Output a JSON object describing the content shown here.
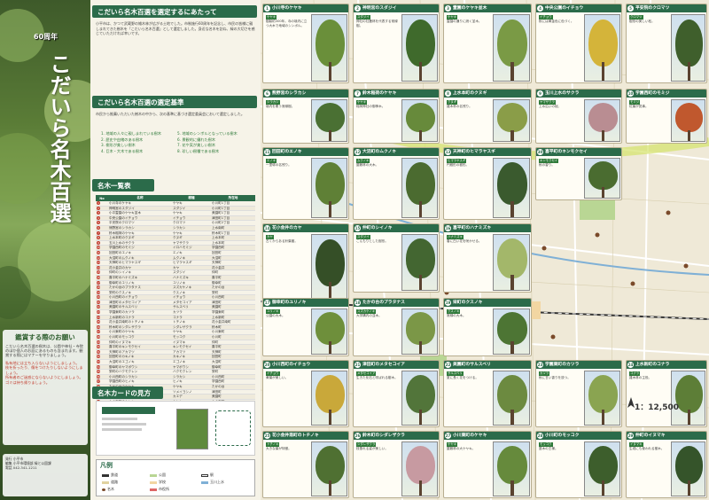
{
  "cover": {
    "anniversary": "60周年",
    "title": "こだいら名木百選",
    "request_title": "鑑賞する際のお願い",
    "request_intro": "こだいら名木百選の樹木は、公園や神社・寺院のほか個人のお庭にあるものも含まれます。観賞する際にはマナーを守りましょう。",
    "request_items": [
      "私有地には立ち入らないようにしましょう。",
      "枝を折ったり、傷をつけたりしないようにしましょう。",
      "所有者のご迷惑にならないようにしましょう。",
      "ゴミは持ち帰りましょう。"
    ],
    "footer": [
      "発行 小平市",
      "編集 小平市環境部 緑と公園課",
      "電話 042-341-1211"
    ]
  },
  "middle": {
    "section1_title": "こだいら名木百選を選定するにあたって",
    "section1_text": "小平市は、かつて武蔵野の雑木林が広がる土地でした。市制施行60周年を記念し、市民の皆様に親しまれてきた樹木を「こだいら名木百選」として選定しました。身近な名木を訪ね、緑の大切さを感じていただければ幸いです。",
    "section2_title": "こだいら名木百選の選定基準",
    "section2_text": "市民から推薦いただいた樹木の中から、次の基準に基づき選定委員会において選定しました。",
    "criteria_left": [
      "1. 地域の人々に親しまれている樹木",
      "2. 歴史や由緒のある樹木",
      "3. 樹形が美しい樹木",
      "4. 巨木・大木である樹木"
    ],
    "criteria_right": [
      "5. 地域のシンボルとなっている樹木",
      "6. 景観的に優れた樹木",
      "7. 花や実が美しい樹木",
      "8. 珍しい樹種である樹木"
    ],
    "list_title": "名木一覧表",
    "list_headers": [
      "No",
      "名称",
      "樹種",
      "所在地"
    ],
    "list_rows": [
      [
        "1",
        "小川寺のケヤキ",
        "ケヤキ",
        "小川町1丁目"
      ],
      [
        "2",
        "神明宮のスダジイ",
        "スダジイ",
        "小川町1丁目"
      ],
      [
        "3",
        "小平霊園のケヤキ並木",
        "ケヤキ",
        "美園町1丁目"
      ],
      [
        "4",
        "中央公園のイチョウ",
        "イチョウ",
        "津田町1丁目"
      ],
      [
        "5",
        "平安院のクロマツ",
        "クロマツ",
        "小川町2丁目"
      ],
      [
        "6",
        "熊野宮のシラカシ",
        "シラカシ",
        "上水南町"
      ],
      [
        "7",
        "鈴木稲荷のケヤキ",
        "ケヤキ",
        "鈴木町1丁目"
      ],
      [
        "8",
        "上水本町のクヌギ",
        "クヌギ",
        "上水本町"
      ],
      [
        "9",
        "玉川上水のサクラ",
        "ヤマザクラ",
        "上水本町"
      ],
      [
        "10",
        "学園西町のモミジ",
        "イロハモミジ",
        "学園西町"
      ],
      [
        "11",
        "回田町のエノキ",
        "エノキ",
        "回田町"
      ],
      [
        "12",
        "大沼町のムクノキ",
        "ムクノキ",
        "大沼町"
      ],
      [
        "13",
        "天神町のヒマラヤスギ",
        "ヒマラヤスギ",
        "天神町"
      ],
      [
        "14",
        "花小金井のカヤ",
        "カヤ",
        "花小金井"
      ],
      [
        "15",
        "仲町のシイノキ",
        "スダジイ",
        "仲町"
      ],
      [
        "16",
        "喜平町のハナミズキ",
        "ハナミズキ",
        "喜平町"
      ],
      [
        "17",
        "御幸町のユリノキ",
        "ユリノキ",
        "御幸町"
      ],
      [
        "18",
        "たかの台のプラタナス",
        "スズカケノキ",
        "たかの台"
      ],
      [
        "19",
        "栄町のクスノキ",
        "クスノキ",
        "栄町"
      ],
      [
        "20",
        "小川西町のイチョウ",
        "イチョウ",
        "小川西町"
      ],
      [
        "21",
        "津田町のメタセコイア",
        "メタセコイア",
        "津田町"
      ],
      [
        "22",
        "美園町のサルスベリ",
        "サルスベリ",
        "美園町"
      ],
      [
        "23",
        "学園東町のカツラ",
        "カツラ",
        "学園東町"
      ],
      [
        "24",
        "上水新町のコナラ",
        "コナラ",
        "上水新町"
      ],
      [
        "25",
        "花小金井南町のトチノキ",
        "トチノキ",
        "花小金井南町"
      ],
      [
        "26",
        "鈴木町のシダレザクラ",
        "シダレザクラ",
        "鈴木町"
      ],
      [
        "27",
        "小川東町のケヤキ",
        "ケヤキ",
        "小川東町"
      ],
      [
        "28",
        "小川町のモッコク",
        "モッコク",
        "小川町"
      ],
      [
        "29",
        "仲町のイヌマキ",
        "イヌマキ",
        "仲町"
      ],
      [
        "30",
        "喜平町のキンモクセイ",
        "キンモクセイ",
        "喜平町"
      ],
      [
        "31",
        "天神町のアカマツ",
        "アカマツ",
        "天神町"
      ],
      [
        "32",
        "回田町のカキノキ",
        "カキノキ",
        "回田町"
      ],
      [
        "33",
        "大沼町のエゴノキ",
        "エゴノキ",
        "大沼町"
      ],
      [
        "34",
        "御幸町のヤマボウシ",
        "ヤマボウシ",
        "御幸町"
      ],
      [
        "35",
        "栄町のハクモクレン",
        "ハクモクレン",
        "栄町"
      ],
      [
        "36",
        "小川西町のシラカシ",
        "シラカシ",
        "小川西町"
      ],
      [
        "37",
        "学園西町のヒノキ",
        "ヒノキ",
        "学園西町"
      ],
      [
        "38",
        "たかの台のケヤキ",
        "ケヤキ",
        "たかの台"
      ],
      [
        "39",
        "津田町のサクラ",
        "ソメイヨシノ",
        "津田町"
      ],
      [
        "40",
        "美園町のカエデ",
        "カエデ",
        "美園町"
      ],
      [
        "41",
        "上水本町のケヤキ",
        "ケヤキ",
        "上水本町"
      ],
      [
        "42",
        "花小金井のイチョウ",
        "イチョウ",
        "花小金井"
      ],
      [
        "43",
        "鈴木町のスギ",
        "スギ",
        "鈴木町"
      ],
      [
        "44",
        "小川東町のクスノキ",
        "クスノキ",
        "小川東町"
      ],
      [
        "45",
        "仲町のケヤキ",
        "ケヤキ",
        "仲町"
      ],
      [
        "46",
        "喜平町のサクラ",
        "ソメイヨシノ",
        "喜平町"
      ],
      [
        "47",
        "天神町のシイノキ",
        "スダジイ",
        "天神町"
      ],
      [
        "48",
        "回田町のエノキ",
        "エノキ",
        "回田町"
      ]
    ],
    "howto_title": "名木カードの見方",
    "legend_title": "凡例",
    "legend_items": [
      "鉄道",
      "道路",
      "名木",
      "公園",
      "学校",
      "市役所",
      "駅",
      "玉川上水"
    ]
  },
  "map": {
    "scale_label": "1：12,500",
    "cards": [
      {
        "no": "1",
        "name": "小川寺のケヤキ",
        "tag": "ケヤキ",
        "text": "樹齢約300年。寺の境内に立つ大木で地域のシンボル。",
        "canopy": "#6a8f3a"
      },
      {
        "no": "2",
        "name": "神明宮のスダジイ",
        "tag": "スダジイ",
        "text": "神社の社叢林を代表する常緑樹。",
        "canopy": "#3f6a2c"
      },
      {
        "no": "3",
        "name": "霊園のケヤキ並木",
        "tag": "ケヤキ",
        "text": "霊園の通りに続く並木。",
        "canopy": "#7a9a45"
      },
      {
        "no": "4",
        "name": "中央公園のイチョウ",
        "tag": "イチョウ",
        "text": "秋には黄金色に色づく。",
        "canopy": "#d4b43a"
      },
      {
        "no": "5",
        "name": "平安院のクロマツ",
        "tag": "クロマツ",
        "text": "樹形の美しい松。",
        "canopy": "#3f5f2c"
      },
      {
        "no": "6",
        "name": "熊野宮のシラカシ",
        "tag": "シラカシ",
        "text": "境内を覆う常緑樹。",
        "canopy": "#4a7033"
      },
      {
        "no": "7",
        "name": "鈴木稲荷のケヤキ",
        "tag": "ケヤキ",
        "text": "稲荷神社の御神木。",
        "canopy": "#678a3b"
      },
      {
        "no": "8",
        "name": "上水本町のクヌギ",
        "tag": "クヌギ",
        "text": "雑木林の名残り。",
        "canopy": "#8a9d48"
      },
      {
        "no": "9",
        "name": "玉川上水のサクラ",
        "tag": "ヤマザクラ",
        "text": "上水沿いの桜。",
        "canopy": "#b98d92"
      },
      {
        "no": "10",
        "name": "学園西町のモミジ",
        "tag": "モミジ",
        "text": "紅葉が見事。",
        "canopy": "#c0582e"
      },
      {
        "no": "11",
        "name": "回田町のエノキ",
        "tag": "エノキ",
        "text": "一里塚の名残り。",
        "canopy": "#5f8036"
      },
      {
        "no": "12",
        "name": "大沼町のムクノキ",
        "tag": "ムクノキ",
        "text": "屋敷林の大木。",
        "canopy": "#4b6b30"
      },
      {
        "no": "13",
        "name": "天神町のヒマラヤスギ",
        "tag": "ヒマラヤスギ",
        "text": "円錐形の樹形。",
        "canopy": "#3a5a2e"
      },
      {
        "no": "14",
        "name": "花小金井のカヤ",
        "tag": "カヤ",
        "text": "古くからある針葉樹。",
        "canopy": "#354f27"
      },
      {
        "no": "15",
        "name": "仲町のシイノキ",
        "tag": "スダジイ",
        "text": "こんもりとした樹形。",
        "canopy": "#436631"
      },
      {
        "no": "16",
        "name": "喜平町のハナミズキ",
        "tag": "ハナミズキ",
        "text": "春に白い花を咲かせる。",
        "canopy": "#a3b76a"
      },
      {
        "no": "17",
        "name": "御幸町のユリノキ",
        "tag": "ユリノキ",
        "text": "公園の大木。",
        "canopy": "#6e8f3b"
      },
      {
        "no": "18",
        "name": "たかの台のプラタナス",
        "tag": "スズカケノキ",
        "text": "大学構内の並木。",
        "canopy": "#7b9747"
      },
      {
        "no": "19",
        "name": "栄町のクスノキ",
        "tag": "クスノキ",
        "text": "常緑の大木。",
        "canopy": "#4d7534"
      },
      {
        "no": "20",
        "name": "小川西町のイチョウ",
        "tag": "イチョウ",
        "text": "黄葉が美しい。",
        "canopy": "#c9a83a"
      },
      {
        "no": "21",
        "name": "津田町のメタセコイア",
        "tag": "メタセコイア",
        "text": "生きた化石と呼ばれる樹木。",
        "canopy": "#52753a"
      },
      {
        "no": "22",
        "name": "美園町のサルスベリ",
        "tag": "サルスベリ",
        "text": "夏に長く花をつける。",
        "canopy": "#6c8a40"
      },
      {
        "no": "23",
        "name": "学園東町のカツラ",
        "tag": "カツラ",
        "text": "秋に甘い香りを放つ。",
        "canopy": "#8aa451"
      },
      {
        "no": "24",
        "name": "上水新町のコナラ",
        "tag": "コナラ",
        "text": "雑木林の主役。",
        "canopy": "#5d7e37"
      },
      {
        "no": "25",
        "name": "花小金井南町のトチノキ",
        "tag": "トチノキ",
        "text": "大きな葉が特徴。",
        "canopy": "#4f7032"
      },
      {
        "no": "26",
        "name": "鈴木町のシダレザクラ",
        "tag": "シダレザクラ",
        "text": "枝垂れる姿が美しい。",
        "canopy": "#c79aa1"
      },
      {
        "no": "27",
        "name": "小川東町のケヤキ",
        "tag": "ケヤキ",
        "text": "屋敷林の大ケヤキ。",
        "canopy": "#668a3c"
      },
      {
        "no": "28",
        "name": "小川町のモッコク",
        "tag": "モッコク",
        "text": "庭木の王様。",
        "canopy": "#3d5e2c"
      },
      {
        "no": "29",
        "name": "仲町のイヌマキ",
        "tag": "イヌマキ",
        "text": "生垣にも使われる樹木。",
        "canopy": "#35542a"
      },
      {
        "no": "30",
        "name": "喜平町のキンモクセイ",
        "tag": "キンモクセイ",
        "text": "秋の香り。",
        "canopy": "#4a6c30"
      }
    ]
  }
}
